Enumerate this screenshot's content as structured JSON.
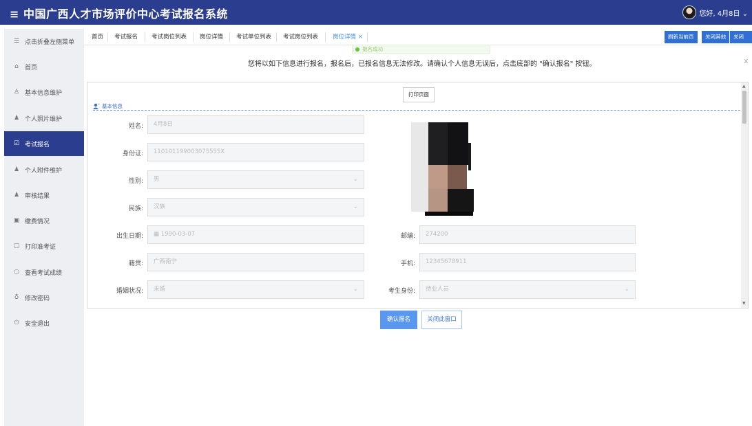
{
  "app": {
    "title": "≡ 中国广西人才市场评价中心考试报名系统"
  },
  "user": {
    "greeting": "您好, 4月8日 ⌄"
  },
  "sidebar": {
    "items": [
      {
        "label": "点击折叠左侧菜单",
        "icon": "menu-icon"
      },
      {
        "label": "首页",
        "icon": "home-icon"
      },
      {
        "label": "基本信息维护",
        "icon": "user-outline-icon"
      },
      {
        "label": "个人照片维护",
        "icon": "user-icon"
      },
      {
        "label": "考试报名",
        "icon": "edit-icon",
        "active": true
      },
      {
        "label": "个人附件维护",
        "icon": "user-icon"
      },
      {
        "label": "审核结果",
        "icon": "user-icon"
      },
      {
        "label": "缴费情况",
        "icon": "payment-icon"
      },
      {
        "label": "打印准考证",
        "icon": "print-icon"
      },
      {
        "label": "查看考试成绩",
        "icon": "search-icon"
      },
      {
        "label": "修改密码",
        "icon": "key-icon"
      },
      {
        "label": "安全退出",
        "icon": "power-icon"
      }
    ]
  },
  "tabs": {
    "items": [
      "首页",
      "考试报名",
      "考试岗位列表",
      "岗位详情",
      "考试单位列表",
      "考试岗位列表",
      "岗位详情 ×"
    ],
    "active_index": 6,
    "actions": [
      "刷新当前页",
      "关闭其他",
      "关闭所有"
    ]
  },
  "toast": {
    "text": "报名成功"
  },
  "notice": "您将以如下信息进行报名，报名后，已报名信息无法修改。请确认个人信息无误后，点击底部的 \"确认报名\" 按钮。",
  "close_label": "x",
  "form": {
    "print_label": "打印页面",
    "section_title": "基本信息",
    "fields": {
      "name": {
        "label": "姓名:",
        "value": "4月8日"
      },
      "id_card": {
        "label": "身份证:",
        "value": "110101199003075555X"
      },
      "gender": {
        "label": "性别:",
        "value": "男"
      },
      "ethnicity": {
        "label": "民族:",
        "value": "汉族"
      },
      "birth": {
        "label": "出生日期:",
        "value": "1990-03-07"
      },
      "postcode": {
        "label": "邮编:",
        "value": "274200"
      },
      "native": {
        "label": "籍贯:",
        "value": "广西南宁"
      },
      "phone": {
        "label": "手机:",
        "value": "12345678911"
      },
      "marital": {
        "label": "婚姻状况:",
        "value": "未婚"
      },
      "identity": {
        "label": "考生身份:",
        "value": "待业人员"
      }
    }
  },
  "buttons": {
    "confirm": "确认报名",
    "close_window": "关闭此窗口"
  },
  "colors": {
    "header": "#2b3d8f",
    "accent": "#2f6fd6",
    "confirm": "#5a97ee",
    "success": "#67c23a"
  }
}
